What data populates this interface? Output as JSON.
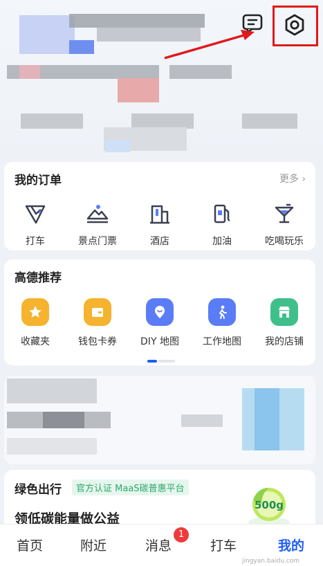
{
  "orders": {
    "title": "我的订单",
    "more": "更多",
    "items": [
      {
        "label": "打车",
        "icon": "taxi-icon"
      },
      {
        "label": "景点门票",
        "icon": "scenic-ticket-icon"
      },
      {
        "label": "酒店",
        "icon": "hotel-icon"
      },
      {
        "label": "加油",
        "icon": "fuel-icon"
      },
      {
        "label": "吃喝玩乐",
        "icon": "cocktail-icon"
      }
    ]
  },
  "recommend": {
    "title": "高德推荐",
    "items": [
      {
        "label": "收藏夹",
        "icon": "star-icon",
        "color": "#f5b32e"
      },
      {
        "label": "钱包卡券",
        "icon": "wallet-icon",
        "color": "#f5b32e"
      },
      {
        "label": "DIY 地图",
        "icon": "diy-map-icon",
        "color": "#5b7cf7"
      },
      {
        "label": "工作地图",
        "icon": "work-map-icon",
        "color": "#5b7cf7"
      },
      {
        "label": "我的店铺",
        "icon": "shop-icon",
        "color": "#3fbf8a"
      }
    ]
  },
  "green": {
    "title": "绿色出行",
    "tag": "官方认证 MaaS碳普惠平台",
    "subtitle": "领低碳能量做公益",
    "badge": "500g"
  },
  "tabs": {
    "home": "首页",
    "nearby": "附近",
    "messages": "消息",
    "taxi": "打车",
    "mine": "我的",
    "messages_badge": "1"
  },
  "watermark": "jingyan.baidu.com",
  "colors": {
    "accent": "#1f5df5",
    "highlight": "#e0191c",
    "badge": "#ee3b3b"
  }
}
